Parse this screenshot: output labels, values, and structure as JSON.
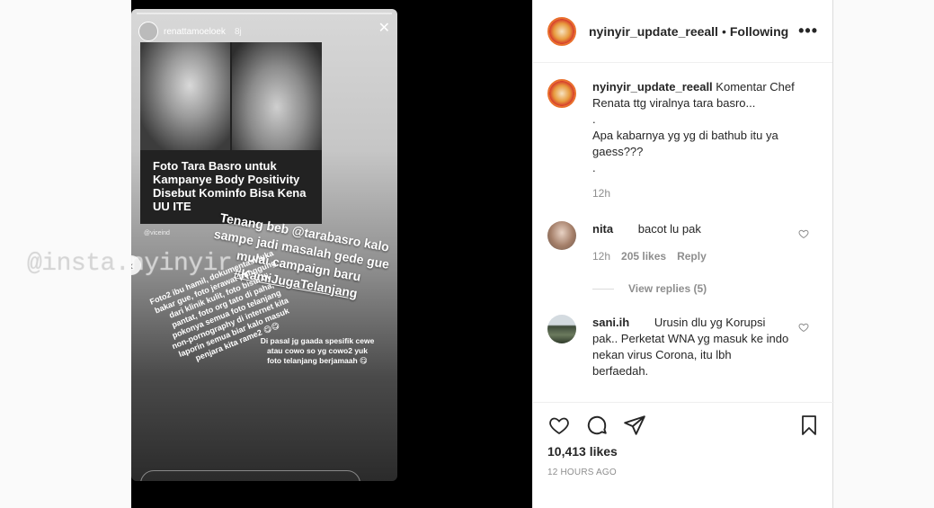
{
  "watermark": "@insta.nyinyir",
  "story": {
    "user": "renattamoeloek",
    "time": "8j",
    "headline": "Foto Tara Basro untuk Kampanye Body Positivity Disebut Kominfo Bisa Kena UU ITE",
    "source_tag": "@viceind",
    "overlay_main": "Tenang beb @tarabasro kalo sampe jadi masalah gede gue mulai campaign baru",
    "overlay_hashtag": "#KamiJugaTelanjang",
    "overlay_left": "Foto2 ibu hamil, dokumentasi luka bakar gue, foto jerawat punggung dari klinik kulit, foto bisul di pantat, foto org tato di paha, pokonya semua foto telanjang non-pornography di internet kita laporin semua biar kalo masuk penjara kita rame2 😋😋",
    "overlay_right": "Di pasal jg gaada spesifik cewe atau cowo so yg cowo2 yuk foto telanjang berjamaah 😋"
  },
  "header": {
    "username": "nyinyir_update_reeall",
    "separator": "•",
    "follow_state": "Following",
    "more": "•••"
  },
  "caption": {
    "username": "nyinyir_update_reeall",
    "lines": [
      "Komentar Chef Renata ttg viralnya tara basro...",
      ".",
      "Apa kabarnya yg yg di bathub itu ya gaess???",
      "."
    ],
    "time": "12h"
  },
  "comments": [
    {
      "username": "nita",
      "text": "bacot lu pak",
      "time": "12h",
      "likes": "205 likes",
      "reply": "Reply",
      "view_replies": "View replies (5)"
    },
    {
      "username": "sani.ih",
      "text": "Urusin dlu yg Korupsi pak.. Perketat WNA yg masuk ke indo nekan virus Corona, itu lbh berfaedah."
    }
  ],
  "footer": {
    "likes": "10,413 likes",
    "posted": "12 HOURS AGO"
  },
  "colors": {
    "text": "#262626",
    "muted": "#8e8e8e",
    "border": "#efefef",
    "accent_ring": "#e9702c"
  }
}
